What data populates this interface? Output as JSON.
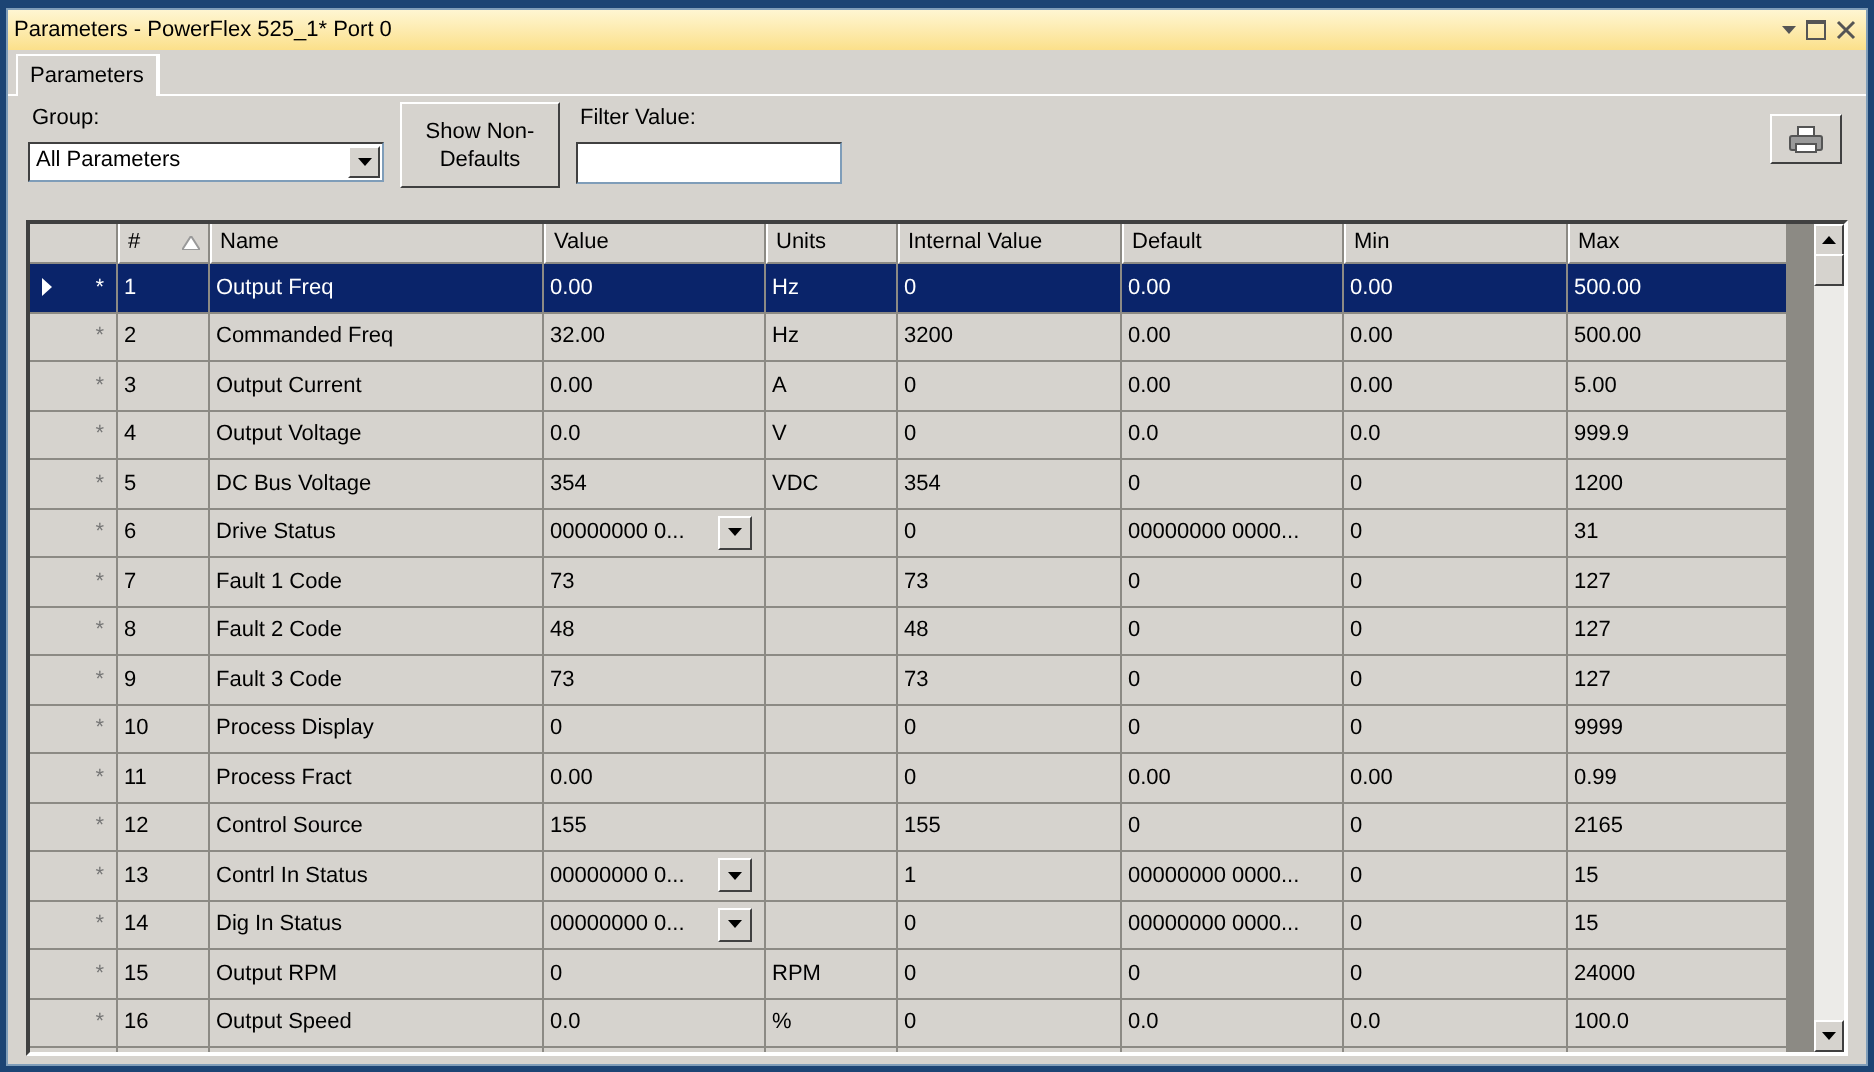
{
  "window": {
    "title": "Parameters - PowerFlex 525_1* Port 0"
  },
  "tabs": [
    {
      "label": "Parameters",
      "selected": true
    }
  ],
  "toolbar": {
    "group_label": "Group:",
    "group_value": "All Parameters",
    "button": "Show Non-Defaults",
    "filter_label": "Filter Value:"
  },
  "table": {
    "columns": [
      {
        "label": "#",
        "sorted": true
      },
      {
        "label": "Name",
        "sorted": false
      },
      {
        "label": "Value",
        "sorted": false
      },
      {
        "label": "Units",
        "sorted": false
      },
      {
        "label": "Internal Value",
        "sorted": false
      },
      {
        "label": "Default",
        "sorted": false
      },
      {
        "label": "Min",
        "sorted": false
      },
      {
        "label": "Max",
        "sorted": false
      }
    ],
    "rows": [
      {
        "current": true,
        "selected": true,
        "marker": "*",
        "number": "1",
        "name": "Output Freq",
        "value": "0.00",
        "kind": "text",
        "units": "Hz",
        "internal": "0",
        "default": "0.00",
        "min": "0.00",
        "max": "500.00"
      },
      {
        "current": false,
        "selected": false,
        "marker": "*",
        "number": "2",
        "name": "Commanded Freq",
        "value": "32.00",
        "kind": "text",
        "units": "Hz",
        "internal": "3200",
        "default": "0.00",
        "min": "0.00",
        "max": "500.00"
      },
      {
        "current": false,
        "selected": false,
        "marker": "*",
        "number": "3",
        "name": "Output Current",
        "value": "0.00",
        "kind": "text",
        "units": "A",
        "internal": "0",
        "default": "0.00",
        "min": "0.00",
        "max": "5.00"
      },
      {
        "current": false,
        "selected": false,
        "marker": "*",
        "number": "4",
        "name": "Output Voltage",
        "value": "0.0",
        "kind": "text",
        "units": "V",
        "internal": "0",
        "default": "0.0",
        "min": "0.0",
        "max": "999.9"
      },
      {
        "current": false,
        "selected": false,
        "marker": "*",
        "number": "5",
        "name": "DC Bus Voltage",
        "value": "354",
        "kind": "text",
        "units": "VDC",
        "internal": "354",
        "default": "0",
        "min": "0",
        "max": "1200"
      },
      {
        "current": false,
        "selected": false,
        "marker": "*",
        "number": "6",
        "name": "Drive Status",
        "value": "00000000 0...",
        "kind": "dropdown",
        "internal": "0",
        "default": "00000000 0000...",
        "min": "0",
        "max": "31"
      },
      {
        "current": false,
        "selected": false,
        "marker": "*",
        "number": "7",
        "name": "Fault 1 Code",
        "value": "73",
        "kind": "text",
        "internal": "73",
        "default": "0",
        "min": "0",
        "max": "127"
      },
      {
        "current": false,
        "selected": false,
        "marker": "*",
        "number": "8",
        "name": "Fault 2 Code",
        "value": "48",
        "kind": "text",
        "internal": "48",
        "default": "0",
        "min": "0",
        "max": "127"
      },
      {
        "current": false,
        "selected": false,
        "marker": "*",
        "number": "9",
        "name": "Fault 3 Code",
        "value": "73",
        "kind": "text",
        "internal": "73",
        "default": "0",
        "min": "0",
        "max": "127"
      },
      {
        "current": false,
        "selected": false,
        "marker": "*",
        "number": "10",
        "name": "Process Display",
        "value": "0",
        "kind": "text",
        "internal": "0",
        "default": "0",
        "min": "0",
        "max": "9999"
      },
      {
        "current": false,
        "selected": false,
        "marker": "*",
        "number": "11",
        "name": "Process Fract",
        "value": "0.00",
        "kind": "text",
        "internal": "0",
        "default": "0.00",
        "min": "0.00",
        "max": "0.99"
      },
      {
        "current": false,
        "selected": false,
        "marker": "*",
        "number": "12",
        "name": "Control Source",
        "value": "155",
        "kind": "text",
        "internal": "155",
        "default": "0",
        "min": "0",
        "max": "2165"
      },
      {
        "current": false,
        "selected": false,
        "marker": "*",
        "number": "13",
        "name": "Contrl In Status",
        "value": "00000000 0...",
        "kind": "dropdown",
        "internal": "1",
        "default": "00000000 0000...",
        "min": "0",
        "max": "15"
      },
      {
        "current": false,
        "selected": false,
        "marker": "*",
        "number": "14",
        "name": "Dig In Status",
        "value": "00000000 0...",
        "kind": "dropdown",
        "internal": "0",
        "default": "00000000 0000...",
        "min": "0",
        "max": "15"
      },
      {
        "current": false,
        "selected": false,
        "marker": "*",
        "number": "15",
        "name": "Output RPM",
        "value": "0",
        "kind": "text",
        "units": "RPM",
        "internal": "0",
        "default": "0",
        "min": "0",
        "max": "24000"
      },
      {
        "current": false,
        "selected": false,
        "marker": "*",
        "number": "16",
        "name": "Output Speed",
        "value": "0.0",
        "kind": "text",
        "units": "%",
        "internal": "0",
        "default": "0.0",
        "min": "0.0",
        "max": "100.0"
      }
    ]
  }
}
